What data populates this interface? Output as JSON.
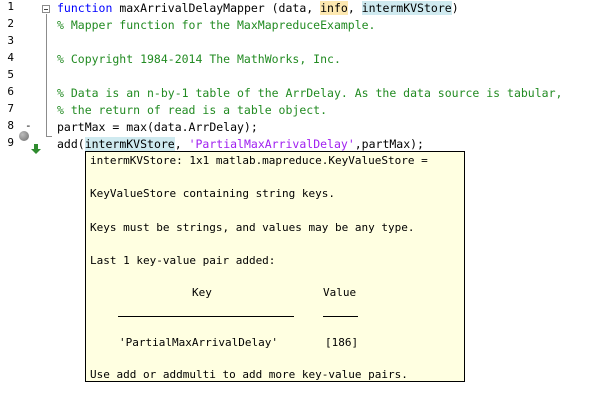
{
  "editor": {
    "line_numbers": [
      "1",
      "2",
      "3",
      "4",
      "5",
      "6",
      "7",
      "8",
      "9"
    ],
    "dash_marks": [
      "-",
      "-"
    ],
    "lines": {
      "l1": {
        "kw": "function",
        "name": " maxArrivalDelayMapper (data, ",
        "info": "info",
        "sep": ", ",
        "store": "intermKVStore",
        "close": ")"
      },
      "l2": "% Mapper function for the MaxMapreduceExample.",
      "l3": "",
      "l4": "% Copyright 1984-2014 The MathWorks, Inc.",
      "l5": "",
      "l6": "% Data is an n-by-1 table of the ArrDelay. As the data source is tabular,",
      "l7": "% the return of read is a table object.",
      "l8": "partMax = max(data.ArrDelay);",
      "l9": {
        "pre": "add(",
        "store": "intermKVStore",
        "sep": ", ",
        "str": "'PartialMaxArrivalDelay'",
        "post": ",partMax);"
      }
    }
  },
  "tooltip": {
    "header": "intermKVStore: 1x1 matlab.mapreduce.KeyValueStore =",
    "desc1": "KeyValueStore containing string keys.",
    "desc2": "Keys must be strings, and values may be any type.",
    "desc3": "Last 1 key-value pair added:",
    "col_key": "Key",
    "col_value": "Value",
    "row_key": "'PartialMaxArrivalDelay'",
    "row_value": "[186]",
    "footer": "Use add or addmulti to add more key-value pairs."
  }
}
